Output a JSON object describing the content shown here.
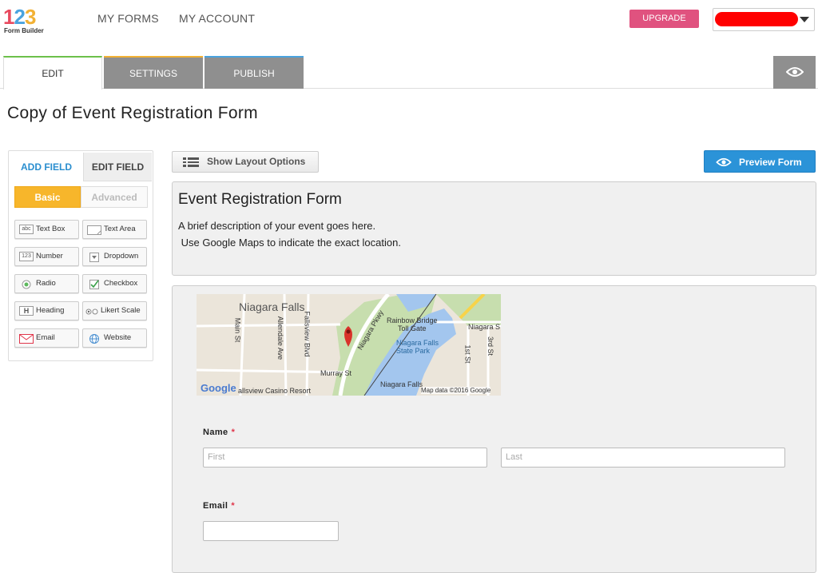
{
  "logo": {
    "digits": [
      "1",
      "2",
      "3"
    ],
    "subtitle": "Form Builder"
  },
  "nav": {
    "my_forms": "MY FORMS",
    "my_account": "MY ACCOUNT"
  },
  "upgrade_label": "UPGRADE",
  "account": {
    "name": "",
    "redacted_color": "#ff0000"
  },
  "tabs": {
    "edit": "EDIT",
    "settings": "SETTINGS",
    "publish": "PUBLISH"
  },
  "page_title": "Copy of Event Registration Form",
  "left_panel": {
    "tabs": {
      "add_field": "ADD FIELD",
      "edit_field": "EDIT FIELD"
    },
    "segments": {
      "basic": "Basic",
      "advanced": "Advanced"
    },
    "fields": [
      {
        "label": "Text Box",
        "icon": "abc-icon",
        "icon_text": "abc"
      },
      {
        "label": "Text Area",
        "icon": "textarea-icon",
        "icon_text": ""
      },
      {
        "label": "Number",
        "icon": "number-icon",
        "icon_text": "123"
      },
      {
        "label": "Dropdown",
        "icon": "dropdown-icon",
        "icon_text": ""
      },
      {
        "label": "Radio",
        "icon": "radio-icon",
        "icon_text": ""
      },
      {
        "label": "Checkbox",
        "icon": "checkbox-icon",
        "icon_text": ""
      },
      {
        "label": "Heading",
        "icon": "heading-icon",
        "icon_text": "H"
      },
      {
        "label": "Likert Scale",
        "icon": "likert-icon",
        "icon_text": ""
      },
      {
        "label": "Email",
        "icon": "envelope-icon",
        "icon_text": ""
      },
      {
        "label": "Website",
        "icon": "globe-icon",
        "icon_text": ""
      }
    ]
  },
  "toolbar": {
    "layout_options": "Show Layout Options",
    "preview": "Preview Form"
  },
  "form": {
    "title": "Event Registration Form",
    "description": "A brief description of your event goes here.\n Use Google Maps to indicate the exact location.",
    "map": {
      "labels": {
        "city": "Niagara Falls",
        "main": "Main St",
        "allendale": "Allendale Ave",
        "fallsview": "Fallsview Blvd",
        "parkway": "Niagara Pkwy",
        "bridge": "Rainbow Bridge\nToll Gate",
        "niagara_s": "Niagara S",
        "park": "Niagara Falls\nState Park",
        "first": "1st St",
        "third": "3rd St",
        "murray": "Murray St",
        "casino": "allsview Casino Resort",
        "nf_bottom": "Niagara Falls",
        "google": "Google",
        "attribution": "Map data ©2016 Google"
      }
    },
    "name_label": "Name",
    "first_placeholder": "First",
    "last_placeholder": "Last",
    "email_label": "Email",
    "required_mark": "*"
  },
  "colors": {
    "upgrade": "#e0527f",
    "preview": "#2b93d8",
    "basic": "#f7b62b",
    "edit_tab_accent": "#6cc04a",
    "settings_tab_accent": "#f2b134",
    "publish_tab_accent": "#4aa3df"
  }
}
